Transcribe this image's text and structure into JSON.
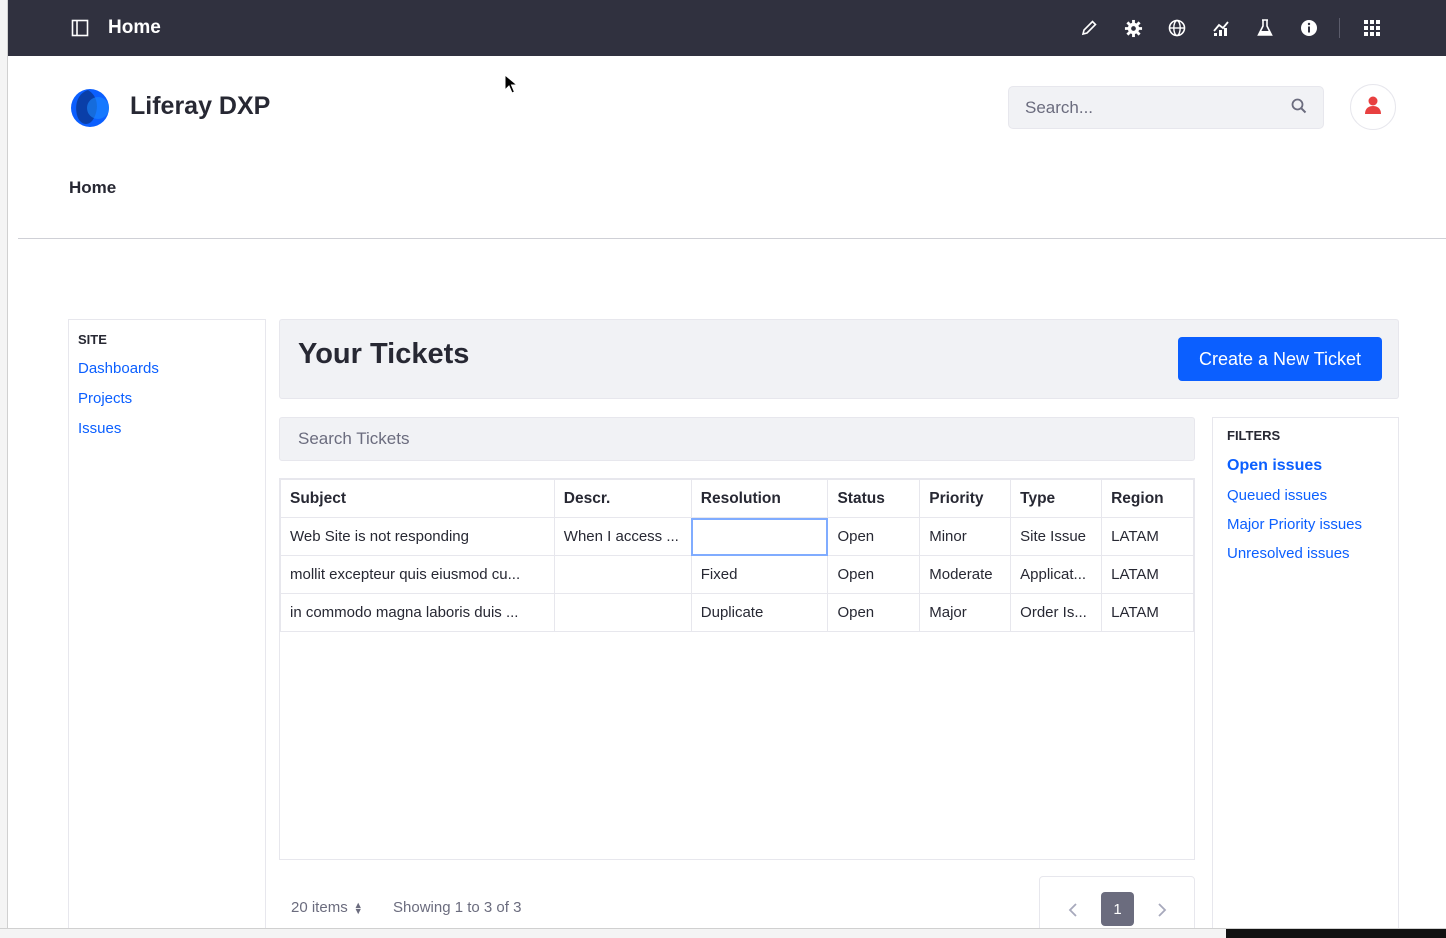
{
  "control_bar": {
    "title": "Home",
    "tools": [
      "edit-icon",
      "gear-icon",
      "globe-icon",
      "analytics-icon",
      "flask-icon",
      "info-icon",
      "apps-grid-icon"
    ]
  },
  "header": {
    "brand": "Liferay DXP",
    "search_placeholder": "Search...",
    "nav_home": "Home"
  },
  "site_nav": {
    "heading": "SITE",
    "items": [
      "Dashboards",
      "Projects",
      "Issues"
    ]
  },
  "tickets": {
    "title": "Your Tickets",
    "create_label": "Create a New Ticket",
    "search_placeholder": "Search Tickets",
    "columns": [
      "Subject",
      "Descr.",
      "Resolution",
      "Status",
      "Priority",
      "Type",
      "Region"
    ],
    "rows": [
      [
        "Web Site is not responding",
        "When I access ...",
        "",
        "Open",
        "Minor",
        "Site Issue",
        "LATAM"
      ],
      [
        "mollit excepteur quis eiusmod cu...",
        "",
        "Fixed",
        "Open",
        "Moderate",
        "Applicat...",
        "LATAM"
      ],
      [
        "in commodo magna laboris duis ...",
        "",
        "Duplicate",
        "Open",
        "Major",
        "Order Is...",
        "LATAM"
      ]
    ]
  },
  "filters": {
    "heading": "FILTERS",
    "items": [
      "Open issues",
      "Queued issues",
      "Major Priority issues",
      "Unresolved issues"
    ]
  },
  "pagination": {
    "page_size": "20 items",
    "showing": "Showing 1 to 3 of 3",
    "current_page": "1"
  },
  "colors": {
    "control_bar": "#30313f",
    "primary": "#0b5fff",
    "avatar": "#e84040"
  }
}
